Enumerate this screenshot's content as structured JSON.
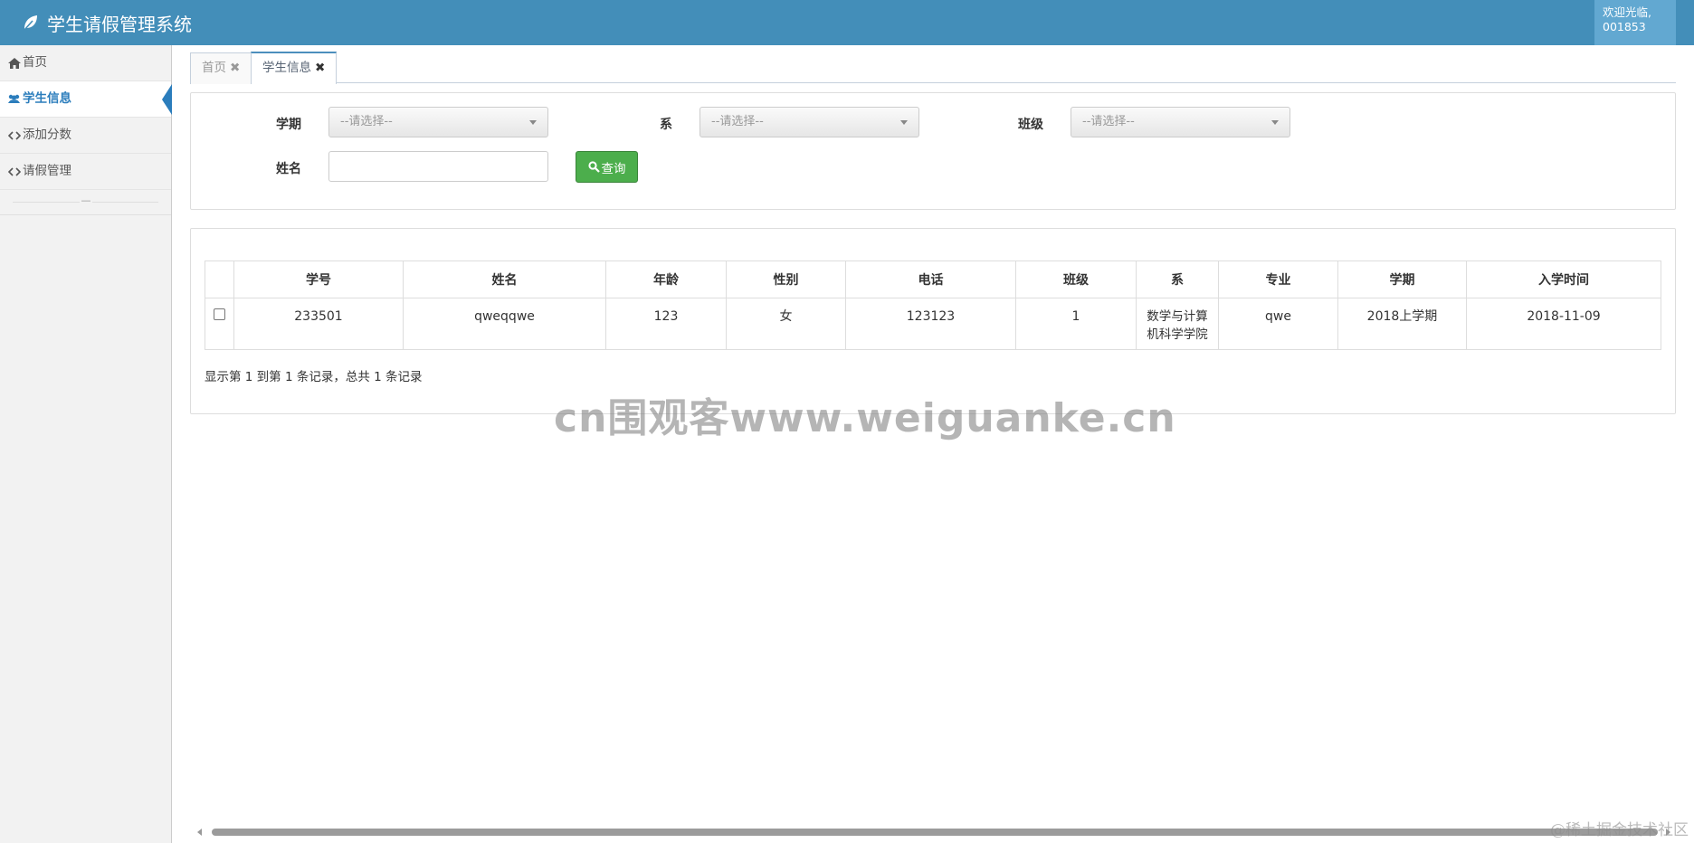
{
  "app": {
    "title": "学生请假管理系统",
    "welcome": "欢迎光临,",
    "user_id": "001853"
  },
  "sidebar": {
    "items": [
      {
        "label": "首页",
        "icon": "home-icon"
      },
      {
        "label": "学生信息",
        "icon": "users-icon"
      },
      {
        "label": "添加分数",
        "icon": "code-icon"
      },
      {
        "label": "请假管理",
        "icon": "code-icon"
      }
    ],
    "collapse": "—"
  },
  "tabs": [
    {
      "label": "首页",
      "close": "✖"
    },
    {
      "label": "学生信息",
      "close": "✖"
    }
  ],
  "search": {
    "term_label": "学期",
    "term_value": "--请选择--",
    "dept_label": "系",
    "dept_value": "--请选择--",
    "class_label": "班级",
    "class_value": "--请选择--",
    "name_label": "姓名",
    "name_value": "",
    "query_button": "查询"
  },
  "table": {
    "headers": [
      "学号",
      "姓名",
      "年龄",
      "性别",
      "电话",
      "班级",
      "系",
      "专业",
      "学期",
      "入学时间"
    ],
    "rows": [
      [
        "233501",
        "qweqqwe",
        "123",
        "女",
        "123123",
        "1",
        "数学与计算机科学学院",
        "qwe",
        "2018上学期",
        "2018-11-09"
      ]
    ],
    "dept_line1": "数学与计算",
    "dept_line2": "机科学学院",
    "page_info": "显示第 1 到第 1 条记录，总共 1 条记录"
  },
  "watermark": "cn围观客www.weiguanke.cn",
  "credit": "@稀土掘金技术社区",
  "colors": {
    "topbar": "#438eb9",
    "accent": "#2b7dbc",
    "query_button": "#4cae4c"
  }
}
